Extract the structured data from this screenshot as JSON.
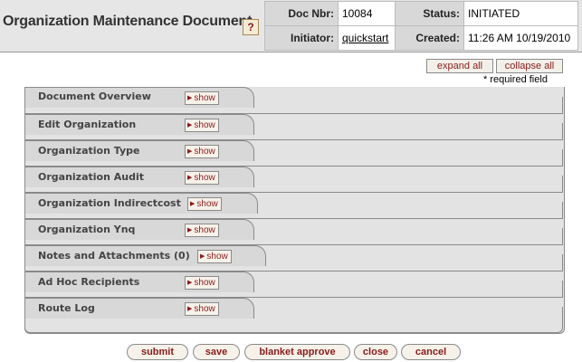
{
  "header": {
    "title": "Organization Maintenance Document",
    "help_icon": "?",
    "doc_nbr_label": "Doc Nbr:",
    "doc_nbr_value": "10084",
    "status_label": "Status:",
    "status_value": "INITIATED",
    "initiator_label": "Initiator:",
    "initiator_value": "quickstart",
    "created_label": "Created:",
    "created_value": "11:26 AM 10/19/2010"
  },
  "toolbar": {
    "expand_all": "expand all",
    "collapse_all": "collapse all",
    "required_note": "* required field"
  },
  "sections": [
    {
      "title": "Document Overview",
      "button": "show"
    },
    {
      "title": "Edit Organization",
      "button": "show"
    },
    {
      "title": "Organization Type",
      "button": "show"
    },
    {
      "title": "Organization Audit",
      "button": "show"
    },
    {
      "title": "Organization Indirectcost",
      "button": "show"
    },
    {
      "title": "Organization Ynq",
      "button": "show"
    },
    {
      "title": "Notes and Attachments (0)",
      "button": "show"
    },
    {
      "title": "Ad Hoc Recipients",
      "button": "show"
    },
    {
      "title": "Route Log",
      "button": "show"
    }
  ],
  "actions": {
    "submit": "submit",
    "save": "save",
    "blanket_approve": "blanket approve",
    "close": "close",
    "cancel": "cancel"
  },
  "colors": {
    "accent": "#8b1a1a",
    "header_bg": "#e6e6e6",
    "section_bg": "#d8d8d8"
  }
}
